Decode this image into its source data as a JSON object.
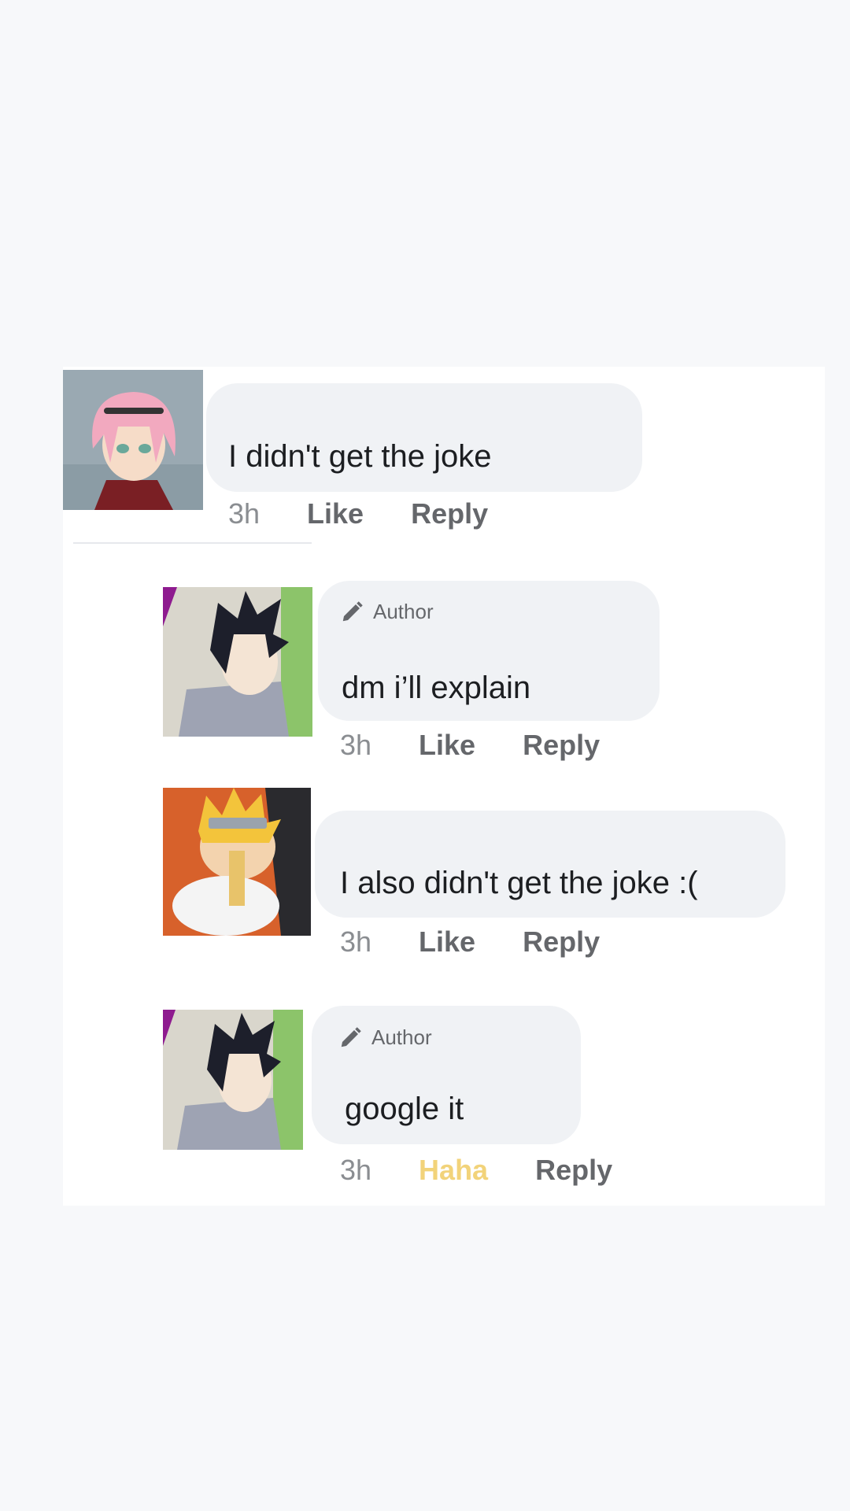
{
  "comments": [
    {
      "author_tag": "",
      "text": "I didn't get the joke",
      "time": "3h",
      "reaction": "Like",
      "reply": "Reply",
      "avatar": "pink-haired-character"
    },
    {
      "author_tag": "Author",
      "text": "dm i’ll explain",
      "time": "3h",
      "reaction": "Like",
      "reply": "Reply",
      "avatar": "dark-haired-character"
    },
    {
      "author_tag": "",
      "text": "I also didn't get the joke :(",
      "time": "3h",
      "reaction": "Like",
      "reply": "Reply",
      "avatar": "blond-character-eating-ramen"
    },
    {
      "author_tag": "Author",
      "text": "google it",
      "time": "3h",
      "reaction": "Haha",
      "reply": "Reply",
      "avatar": "dark-haired-character"
    }
  ],
  "colors": {
    "bubble": "#f0f2f5",
    "meta_gray": "#65676b",
    "haha_yellow": "#f2d37a"
  },
  "icons": {
    "author": "pencil-icon"
  }
}
